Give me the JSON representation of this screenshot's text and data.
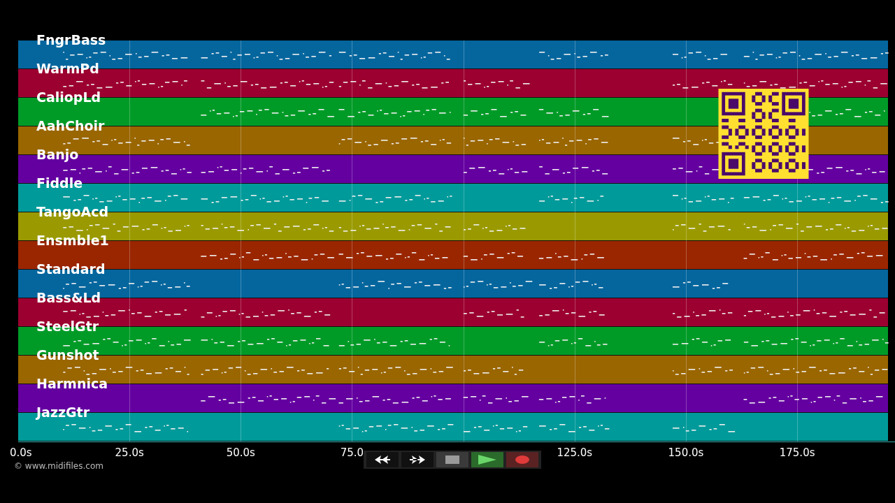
{
  "tracks": [
    {
      "name": "FngrBass",
      "color": "#05669e"
    },
    {
      "name": "WarmPd",
      "color": "#9c0030"
    },
    {
      "name": "CaliopLd",
      "color": "#009b27"
    },
    {
      "name": "AahChoir",
      "color": "#9a6600"
    },
    {
      "name": "Banjo",
      "color": "#6400a0"
    },
    {
      "name": "Fiddle",
      "color": "#009a9a"
    },
    {
      "name": "TangoAcd",
      "color": "#9a9a00"
    },
    {
      "name": "Ensmble1",
      "color": "#9a2600"
    },
    {
      "name": "Standard",
      "color": "#05669e"
    },
    {
      "name": "Bass&Ld",
      "color": "#9c0030"
    },
    {
      "name": "SteelGtr",
      "color": "#009b27"
    },
    {
      "name": "Gunshot",
      "color": "#9a6600"
    },
    {
      "name": "Harmnica",
      "color": "#6400a0"
    },
    {
      "name": "JazzGtr",
      "color": "#009a9a"
    }
  ],
  "axis": {
    "ticks": [
      "0.0s",
      "25.0s",
      "50.0s",
      "75.0",
      "125.0s",
      "150.0s",
      "175.0s"
    ]
  },
  "copyright": "© www.midifiles.com",
  "transport": [
    {
      "kind": "rewind"
    },
    {
      "kind": "forward"
    },
    {
      "kind": "stop"
    },
    {
      "kind": "play"
    },
    {
      "kind": "record"
    }
  ]
}
